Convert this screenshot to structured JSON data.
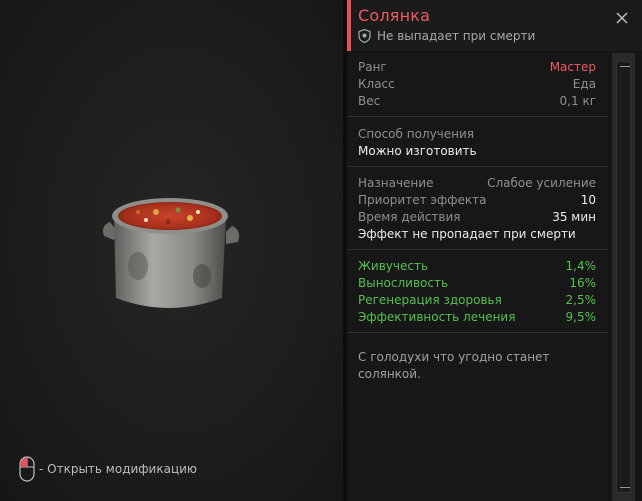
{
  "item": {
    "title": "Солянка",
    "subtitle": "Не выпадает при смерти"
  },
  "stats": [
    {
      "label": "Ранг",
      "value": "Мастер",
      "value_color": "red"
    },
    {
      "label": "Класс",
      "value": "Еда",
      "value_color": "grey"
    },
    {
      "label": "Вес",
      "value": "0,1 кг",
      "value_color": "grey"
    }
  ],
  "source": {
    "label": "Способ получения",
    "value": "Можно изготовить"
  },
  "effect": {
    "purpose_label": "Назначение",
    "purpose_value": "Слабое усиление",
    "priority_label": "Приоритет эффекта",
    "priority_value": "10",
    "duration_label": "Время действия",
    "duration_value": "35 мин",
    "note": "Эффект не пропадает при смерти"
  },
  "bonuses": [
    {
      "label": "Живучесть",
      "value": "1,4%"
    },
    {
      "label": "Выносливость",
      "value": "16%"
    },
    {
      "label": "Регенерация здоровья",
      "value": "2,5%"
    },
    {
      "label": "Эффективность лечения",
      "value": "9,5%"
    }
  ],
  "description": "С голодухи что угодно станет солянкой.",
  "hint": {
    "text": "- Открыть модификацию",
    "icon": "mouse-icon"
  },
  "colors": {
    "accent": "#e8505b",
    "green": "#56c050",
    "background": "#1c1c1c"
  }
}
